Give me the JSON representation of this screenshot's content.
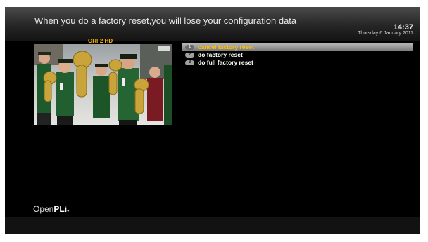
{
  "header": {
    "title": "When you do a factory reset,you will lose your configuration data",
    "time": "14:37",
    "date": "Thursday 6 January 2011"
  },
  "preview": {
    "channel": "ORF2 HD"
  },
  "menu": {
    "items": [
      {
        "number": "1",
        "label": "cancel factory reset",
        "selected": true
      },
      {
        "number": "2",
        "label": "do factory reset",
        "selected": false
      },
      {
        "number": "3",
        "label": "do full factory reset",
        "selected": false
      }
    ]
  },
  "branding": {
    "logo_regular": "Open",
    "logo_bold": "PLi"
  },
  "colors": {
    "selected_text": "#ffc000",
    "channel_label": "#ffb400",
    "background": "#000000"
  }
}
